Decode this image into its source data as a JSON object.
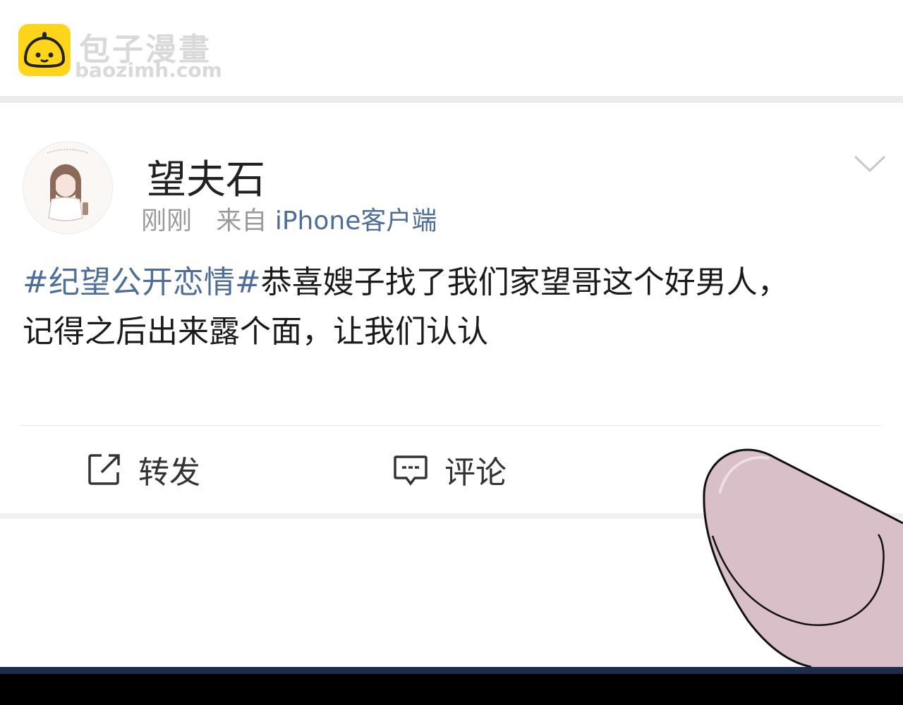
{
  "watermark": {
    "site_name": "包子漫畫",
    "domain": "baozimh.com"
  },
  "post": {
    "username": "望夫石",
    "time": "刚刚",
    "source_prefix": "来自",
    "source_app": "iPhone客户端",
    "hashtag": "#纪望公开恋情#",
    "content_line1": "恭喜嫂子找了我们家望哥这个好男人，",
    "content_line2": "记得之后出来露个面，让我们认认",
    "dropdown_icon": "chevron-down-icon"
  },
  "actions": {
    "repost_label": "转发",
    "comment_label": "评论"
  },
  "colors": {
    "accent_link": "#4e6d99",
    "logo_yellow": "#FFD51C",
    "finger_fill": "#d8bfc8"
  }
}
